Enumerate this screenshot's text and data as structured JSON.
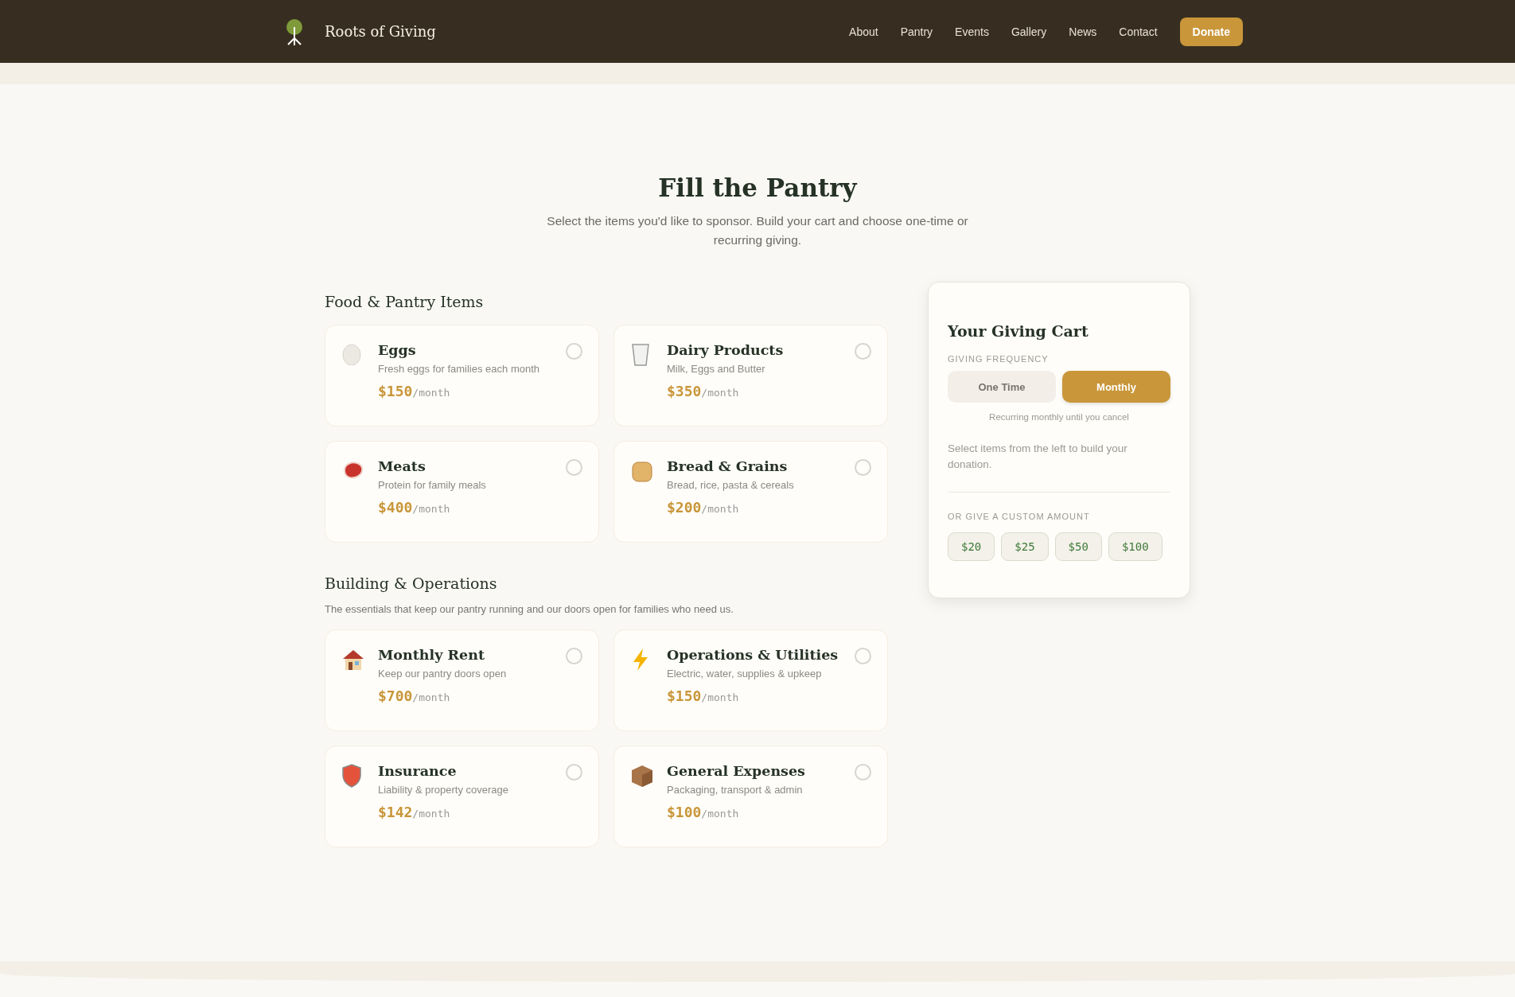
{
  "header": {
    "brand": "Roots of Giving",
    "nav": [
      "About",
      "Pantry",
      "Events",
      "Gallery",
      "News",
      "Contact"
    ],
    "cta": "Donate"
  },
  "hero": {
    "title": "Fill the Pantry",
    "subtitle": "Select the items you'd like to sponsor. Build your cart and choose one-time or recurring giving."
  },
  "sections": [
    {
      "title": "Food & Pantry Items",
      "items": [
        {
          "name": "Eggs",
          "description": "Fresh eggs for families each month",
          "price": "$150",
          "unit": "/month",
          "selected": false
        },
        {
          "name": "Dairy Products",
          "description": "Milk, Eggs and Butter",
          "price": "$350",
          "unit": "/month",
          "selected": false
        },
        {
          "name": "Meats",
          "description": "Protein for family meals",
          "price": "$400",
          "unit": "/month",
          "selected": false
        },
        {
          "name": "Bread & Grains",
          "description": "Bread, rice, pasta & cereals",
          "price": "$200",
          "unit": "/month",
          "selected": false
        }
      ]
    },
    {
      "title": "Building & Operations",
      "description": "The essentials that keep our pantry running and our doors open for families who need us.",
      "items": [
        {
          "name": "Monthly Rent",
          "description": "Keep our pantry doors open",
          "price": "$700",
          "unit": "/month",
          "selected": false
        },
        {
          "name": "Operations & Utilities",
          "description": "Electric, water, supplies & upkeep",
          "price": "$150",
          "unit": "/month",
          "selected": false
        },
        {
          "name": "Insurance",
          "description": "Liability & property coverage",
          "price": "$142",
          "unit": "/month",
          "selected": false
        },
        {
          "name": "General Expenses",
          "description": "Packaging, transport & admin",
          "price": "$100",
          "unit": "/month",
          "selected": false
        }
      ]
    }
  ],
  "cart": {
    "title": "Your Giving Cart",
    "frequency_label": "GIVING FREQUENCY",
    "frequencies": [
      {
        "label": "One Time",
        "selected": false
      },
      {
        "label": "Monthly",
        "selected": true
      }
    ],
    "frequency_note": "Recurring monthly until you cancel",
    "empty_message": "Select items from the left to build your donation.",
    "custom_label": "OR GIVE A CUSTOM AMOUNT",
    "amounts": [
      "$20",
      "$25",
      "$50",
      "$100"
    ]
  }
}
